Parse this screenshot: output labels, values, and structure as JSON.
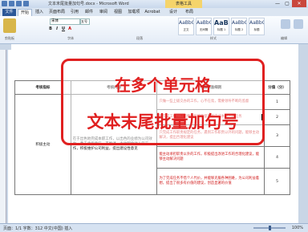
{
  "window": {
    "title": "文本末尾批量加句号.docx - Microsoft Word",
    "context_tab": "表格工具",
    "controls": [
      "—",
      "▢",
      "✕"
    ]
  },
  "tabs": [
    "文件",
    "开始",
    "插入",
    "页面布局",
    "引用",
    "邮件",
    "审阅",
    "视图",
    "加载项",
    "Acrobat",
    "设计",
    "布局"
  ],
  "ribbon": {
    "font_name": "宋体",
    "font_size": "五号",
    "format_buttons": [
      "B",
      "I",
      "U",
      "A"
    ],
    "styles": [
      {
        "sample": "AaBbCcDd",
        "name": "正文"
      },
      {
        "sample": "AaBbCcDd",
        "name": "无间隔"
      },
      {
        "sample": "AaBl",
        "name": "标题 1"
      },
      {
        "sample": "AaBbC",
        "name": "标题 2"
      },
      {
        "sample": "AaBbC",
        "name": "标题"
      }
    ],
    "group_labels": [
      "剪贴板",
      "字体",
      "段落",
      "样式",
      "编辑"
    ]
  },
  "callout": {
    "line1": "在多个单元格",
    "line2": "文本末尾批量加句号"
  },
  "table": {
    "headers": [
      "考核指标",
      "考核内容",
      "考核标准细则",
      "分值（分）"
    ],
    "indicator": "积极主动",
    "content": "在于出色地完成本职工作，以出色的业绩为公司效力，勇于承担责任，不推诿，主动配合他人的工作，积极维护公司利益，提出建设性意见",
    "rows": [
      {
        "std": "只做一些上级交办的工作，心不在焉，需要领导不断的监督",
        "score": "1"
      },
      {
        "std": "能完成工作，不需要领导的监督就能完成本分内的任务",
        "score": "2"
      },
      {
        "std": "只完成工作职责规定的任务，遇到工作职责以外的问题，能够主动解决，提出合理化建议",
        "score": "3"
      },
      {
        "std": "能主动承担职责以外的工作，积极提出改进工作的合理化建议，能够主动解决问题",
        "score": "4"
      },
      {
        "std": "为了完成任务不惜个人代价，并能够克服各种困难，为公司利益着想，提出了很多有价值的建议，创造显著的价值",
        "score": "5"
      }
    ]
  },
  "status": {
    "left": "页面：1/1  字数：312  中文(中国)  插入",
    "zoom": "100%"
  },
  "colors": {
    "accent_red": "#e02020",
    "file_tab": "#2b5797",
    "context_tab": "#f5d46b"
  }
}
